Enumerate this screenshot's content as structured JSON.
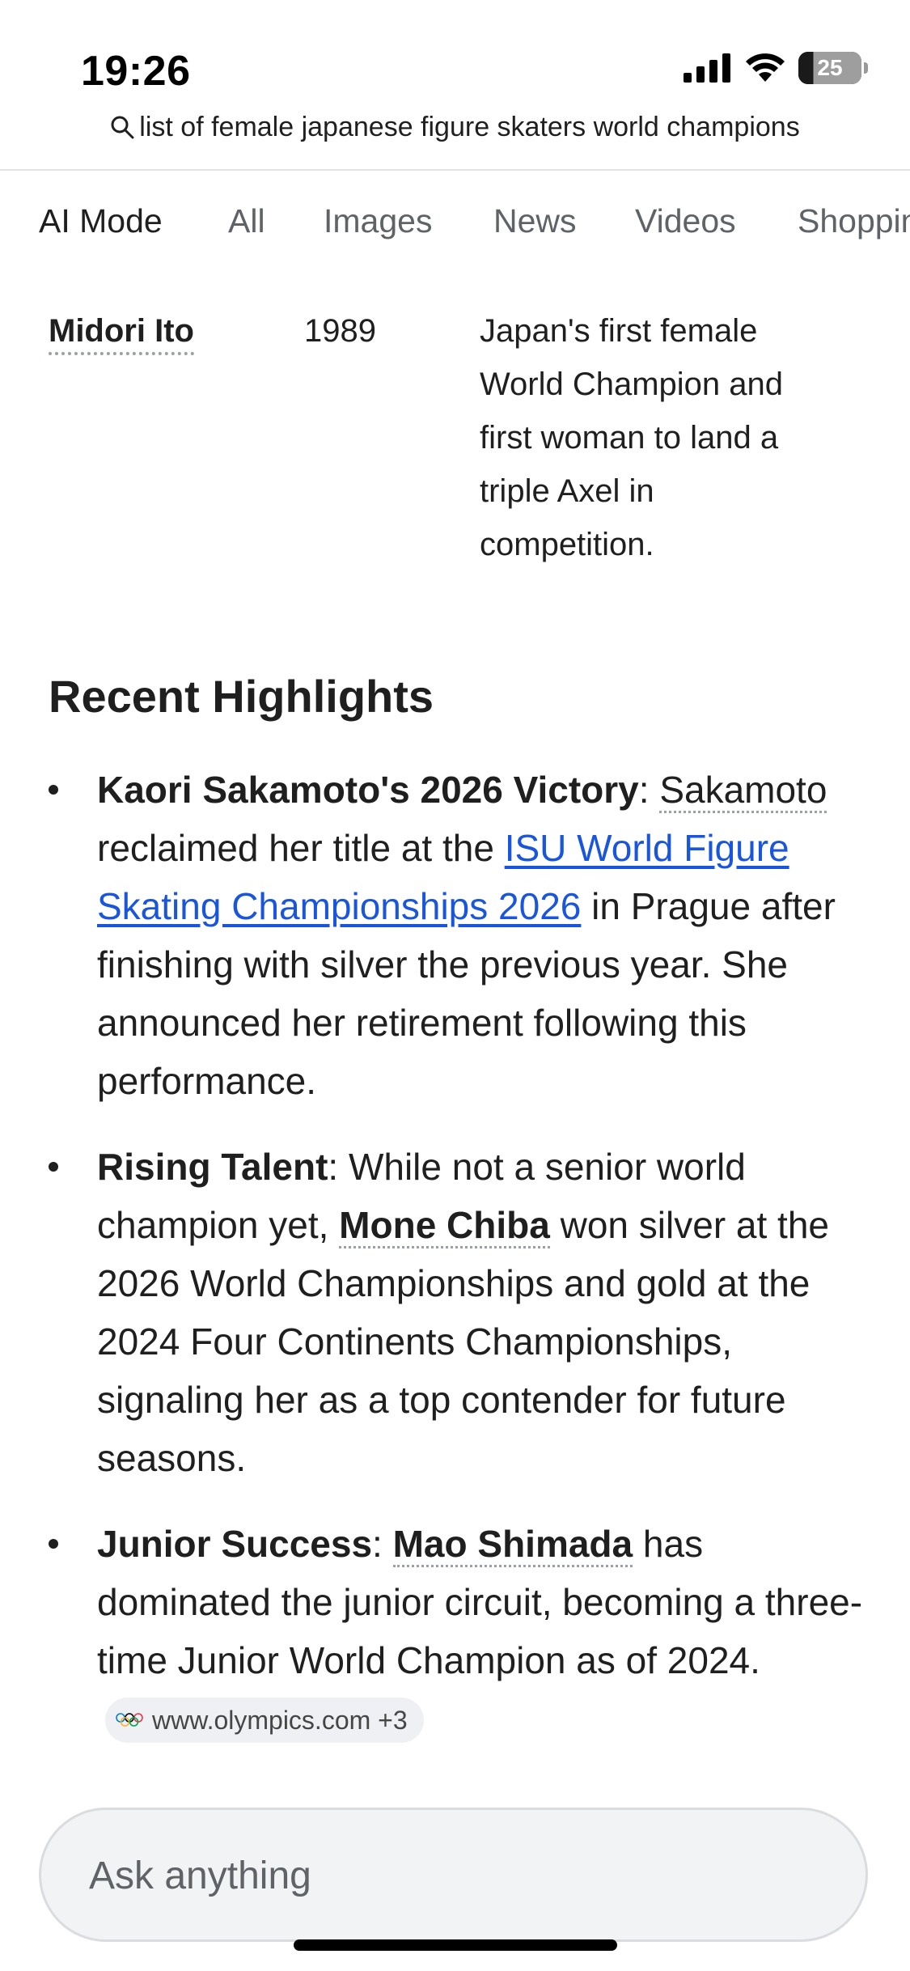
{
  "status": {
    "time": "19:26",
    "battery": "25"
  },
  "browser": {
    "query": "list of female japanese figure skaters world champions"
  },
  "tabs": [
    "AI Mode",
    "All",
    "Images",
    "News",
    "Videos",
    "Shoppin"
  ],
  "table_row": {
    "name": "Midori Ito",
    "year": "1989",
    "note": "Japan's first female World Champion and first woman to land a triple Axel in competition."
  },
  "section": {
    "heading": "Recent Highlights"
  },
  "bullets": [
    {
      "title": "Kaori Sakamoto's 2026 Victory",
      "sep": ":",
      "entity": "Sakamoto",
      "text1": " reclaimed her title at the ",
      "link": "ISU World Figure Skating Championships 2026",
      "text2": " in Prague after finishing with silver the previous year. She announced her retirement following this performance."
    },
    {
      "title": "Rising Talent",
      "text1": ": While not a senior world champion yet, ",
      "entity": "Mone Chiba",
      "text2": " won silver at the 2026 World Championships and gold at the 2024 Four Continents Championships, signaling her as a top contender for future seasons."
    },
    {
      "title": "Junior Success",
      "sep": ": ",
      "entity": "Mao Shimada",
      "text1": " has dominated the junior circuit, becoming a three-time Junior World Champion as of 2024.",
      "source": "www.olympics.com +3"
    }
  ],
  "ask": {
    "placeholder": "Ask anything"
  },
  "colors": {
    "link": "#1a56db",
    "text": "#1f1f1f",
    "muted": "#5f6368"
  }
}
